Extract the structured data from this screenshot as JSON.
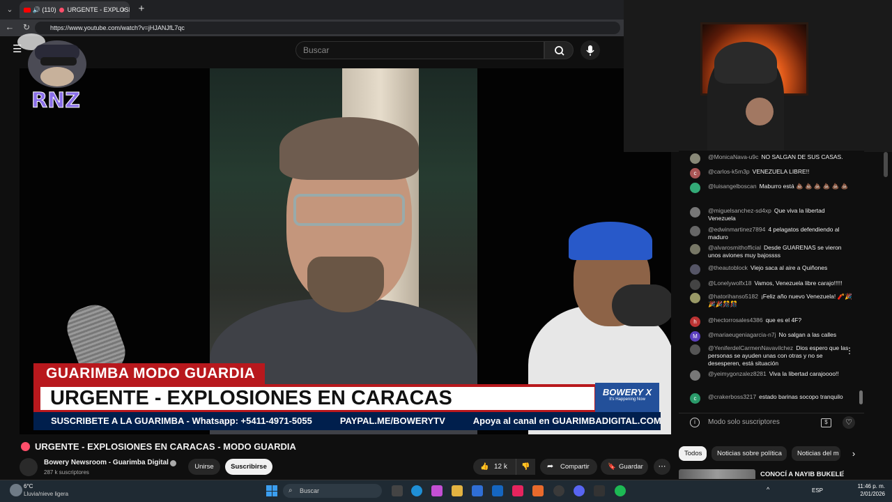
{
  "browser": {
    "tab_count": "(110)",
    "tab_title": "URGENTE - EXPLOSI",
    "tab_close": "×",
    "new_tab": "+",
    "url": "https://www.youtube.com/watch?v=jHJANJfL7qc"
  },
  "youtube": {
    "search_placeholder": "Buscar"
  },
  "video": {
    "modo_banner": "GUARIMBA MODO GUARDIA",
    "headline": "URGENTE - EXPLOSIONES EN CARACAS",
    "badge_brand": "BOWERY X",
    "badge_tagline": "It's Happening Now",
    "ticker": [
      "SUSCRIBETE A LA GUARIMBA - Whatsapp: +5411-4971-5055",
      "PAYPAL.ME/BOWERYTV",
      "Apoya al canal en GUARIMBADIGITAL.COM",
      ":)"
    ]
  },
  "logo": {
    "text": "RNZ"
  },
  "chat": {
    "messages": [
      {
        "author": "@MonicaNava-u9c",
        "text": "NO SALGAN DE SUS CASAS.",
        "avatar": ""
      },
      {
        "author": "@carlos-k5m3p",
        "text": "VENEZUELA LIBRE!!",
        "avatar": "c"
      },
      {
        "author": "@luisangelboscan",
        "text": "Maburro está 💩 💩 💩 💩 💩 💩",
        "avatar": ""
      },
      {
        "author": "@miguelsanchez-sd4xp",
        "text": "Que viva la libertad Venezuela",
        "avatar": ""
      },
      {
        "author": "@edwinmartinez7894",
        "text": "4 pelagatos defendiendo al maduro",
        "avatar": ""
      },
      {
        "author": "@alvarosmithofficial",
        "text": "Desde GUARENAS se vieron unos aviones muy bajossss",
        "avatar": ""
      },
      {
        "author": "@theautoblock",
        "text": "Viejo saca al aire a Quiñones",
        "avatar": ""
      },
      {
        "author": "@Lonelywolfx18",
        "text": "Vamos, Venezuela libre carajo!!!!!",
        "avatar": ""
      },
      {
        "author": "@hatorihanso5182",
        "text": "¡Feliz año nuevo Venezuela! 🧨🎉🎉🎉🎊🎊",
        "avatar": ""
      },
      {
        "author": "@hectorrosales4386",
        "text": "que es el 4F?",
        "avatar": "h"
      },
      {
        "author": "@mariaeugeniagarcia-n7j",
        "text": "No salgan a las calles",
        "avatar": "M"
      },
      {
        "author": "@YeniferdelCarmenNavavilchez",
        "text": "Dios espero que las personas se ayuden unas con otras y no se desesperen, está situación",
        "avatar": ""
      },
      {
        "author": "@yeimygonzalez8281",
        "text": "Viva la libertad carajoooo!!",
        "avatar": ""
      },
      {
        "author": "@crakerboss3217",
        "text": "estado barinas socopo tranquilo",
        "avatar": "c"
      }
    ],
    "mode_text": "Modo solo suscriptores",
    "more_icon": "⋮"
  },
  "watch": {
    "title": "URGENTE - EXPLOSIONES EN CARACAS - MODO GUARDIA",
    "channel": "Bowery Newsroom - Guarimba Digital",
    "subscribers": "287 k suscriptores",
    "join": "Unirse",
    "subscribe": "Suscribirse",
    "likes": "12 k",
    "share": "Compartir",
    "save": "Guardar",
    "more": "⋯"
  },
  "chips": [
    "Todos",
    "Noticias sobre política",
    "Noticias del m"
  ],
  "related": {
    "title": "CONOCÍ A NAYIB BUKELE",
    "more": "⋮"
  },
  "taskbar": {
    "temp": "6°C",
    "weather": "Lluvia/nieve ligera",
    "search": "Buscar",
    "lang": "ESP",
    "time": "11:46 p. m.",
    "date": "2/01/2026"
  },
  "colors": {
    "banner_red": "#b8181d",
    "ticker_navy": "#001f4d",
    "badge_blue": "#23509a"
  }
}
